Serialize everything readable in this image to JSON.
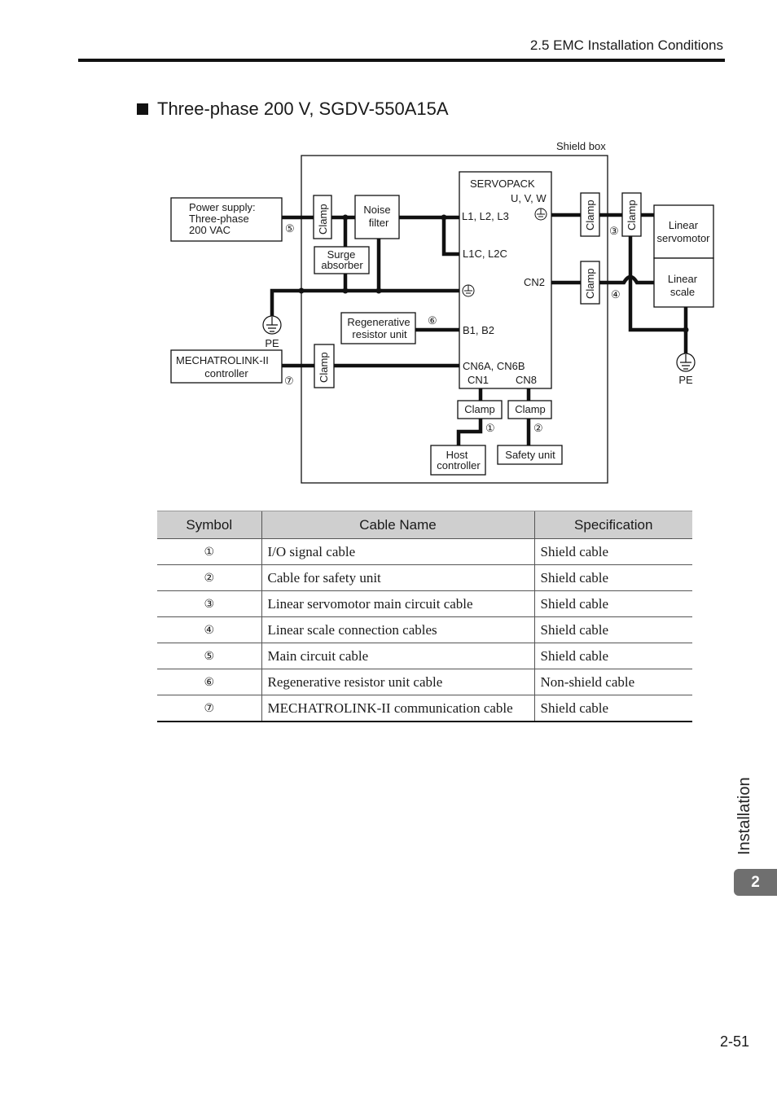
{
  "header": {
    "section": "2.5  EMC Installation Conditions"
  },
  "title": "Three-phase 200 V, SGDV-550A15A",
  "diagram": {
    "shield_box": "Shield box",
    "power_supply": [
      "Power supply:",
      "Three-phase",
      "200 VAC"
    ],
    "clamp": "Clamp",
    "noise_filter": [
      "Noise",
      "filter"
    ],
    "surge_absorber": [
      "Surge",
      "absorber"
    ],
    "servopack": "SERVOPACK",
    "terminals": {
      "uvw": "U, V, W",
      "l123": "L1, L2, L3",
      "l1c2c": "L1C, L2C",
      "cn2": "CN2",
      "b1b2": "B1, B2",
      "cn6": "CN6A, CN6B",
      "cn1": "CN1",
      "cn8": "CN8"
    },
    "pe": "PE",
    "regen": [
      "Regenerative",
      "resistor unit"
    ],
    "mechatrolink": [
      "MECHATROLINK-II",
      "controller"
    ],
    "linear_servomotor": [
      "Linear",
      "servomotor"
    ],
    "linear_scale": [
      "Linear",
      "scale"
    ],
    "host_controller": [
      "Host",
      "controller"
    ],
    "safety_unit": "Safety unit",
    "markers": {
      "m1": "①",
      "m2": "②",
      "m3": "③",
      "m4": "④",
      "m5": "⑤",
      "m6": "⑥",
      "m7": "⑦"
    }
  },
  "table": {
    "headers": [
      "Symbol",
      "Cable Name",
      "Specification"
    ],
    "rows": [
      [
        "①",
        "I/O signal cable",
        "Shield cable"
      ],
      [
        "②",
        "Cable for safety unit",
        "Shield cable"
      ],
      [
        "③",
        "Linear servomotor main circuit cable",
        "Shield cable"
      ],
      [
        "④",
        "Linear scale connection cables",
        "Shield cable"
      ],
      [
        "⑤",
        "Main circuit cable",
        "Shield cable"
      ],
      [
        "⑥",
        "Regenerative resistor unit cable",
        "Non-shield cable"
      ],
      [
        "⑦",
        "MECHATROLINK-II communication cable",
        "Shield cable"
      ]
    ]
  },
  "side_tab": {
    "label": "Installation",
    "chapter": "2"
  },
  "page_number": "2-51"
}
